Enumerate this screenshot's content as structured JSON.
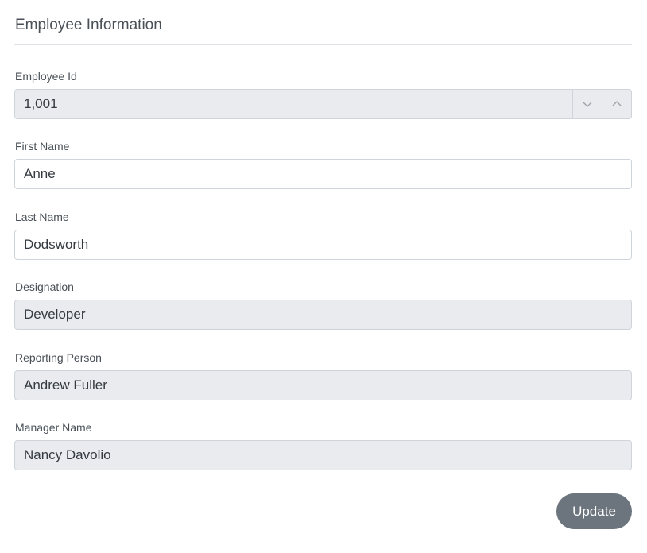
{
  "form": {
    "title": "Employee Information",
    "fields": [
      {
        "label": "Employee Id",
        "value": "1,001",
        "disabled": true
      },
      {
        "label": "First Name",
        "value": "Anne",
        "disabled": false
      },
      {
        "label": "Last Name",
        "value": "Dodsworth",
        "disabled": false
      },
      {
        "label": "Designation",
        "value": "Developer",
        "disabled": true
      },
      {
        "label": "Reporting Person",
        "value": "Andrew Fuller",
        "disabled": true
      },
      {
        "label": "Manager Name",
        "value": "Nancy Davolio",
        "disabled": true
      }
    ],
    "update_label": "Update"
  },
  "icons": {
    "spin_down": "chevron-down-icon",
    "spin_up": "chevron-up-icon"
  },
  "colors": {
    "disabled_bg": "#e9ebee",
    "border": "#ced4da",
    "button_bg": "#6c757d"
  }
}
